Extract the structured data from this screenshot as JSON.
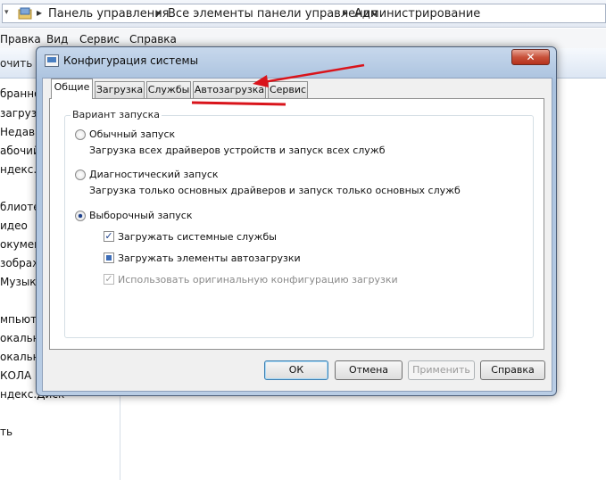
{
  "explorer": {
    "breadcrumbs": [
      "Панель управления",
      "Все элементы панели управления",
      "Администрирование"
    ],
    "menu": [
      "Правка",
      "Вид",
      "Сервис",
      "Справка"
    ],
    "toolbar_label": "очить",
    "nav_items": [
      "бранно",
      "загрузки",
      "Недавни",
      "абочий",
      "ндекс.Д",
      "",
      "блиоте",
      "идео",
      "окумен",
      "зображ",
      "Музыка",
      "",
      "мпьюте",
      "окальн",
      "окальн",
      "КОЛА",
      "ндекс.Диск",
      "",
      "ть"
    ]
  },
  "dialog": {
    "title": "Конфигурация системы",
    "close_symbol": "✕",
    "tabs": [
      "Общие",
      "Загрузка",
      "Службы",
      "Автозагрузка",
      "Сервис"
    ],
    "active_tab": "Общие",
    "group_label": "Вариант запуска",
    "options": [
      {
        "label": "Обычный запуск",
        "description": "Загрузка всех драйверов устройств и запуск всех служб",
        "selected": false
      },
      {
        "label": "Диагностический запуск",
        "description": "Загрузка только основных драйверов и запуск только основных служб",
        "selected": false
      },
      {
        "label": "Выборочный запуск",
        "description": "",
        "selected": true
      }
    ],
    "checkboxes": [
      {
        "label": "Загружать системные службы",
        "state": "checked",
        "enabled": true
      },
      {
        "label": "Загружать элементы автозагрузки",
        "state": "mixed",
        "enabled": true
      },
      {
        "label": "Использовать оригинальную конфигурацию загрузки",
        "state": "checked",
        "enabled": false
      }
    ],
    "check_symbol": "✓",
    "buttons": {
      "ok": "ОК",
      "cancel": "Отмена",
      "apply": "Применить",
      "help": "Справка"
    }
  },
  "annotation": {
    "color": "#d9141b",
    "highlighted_tab": "Автозагрузка"
  }
}
